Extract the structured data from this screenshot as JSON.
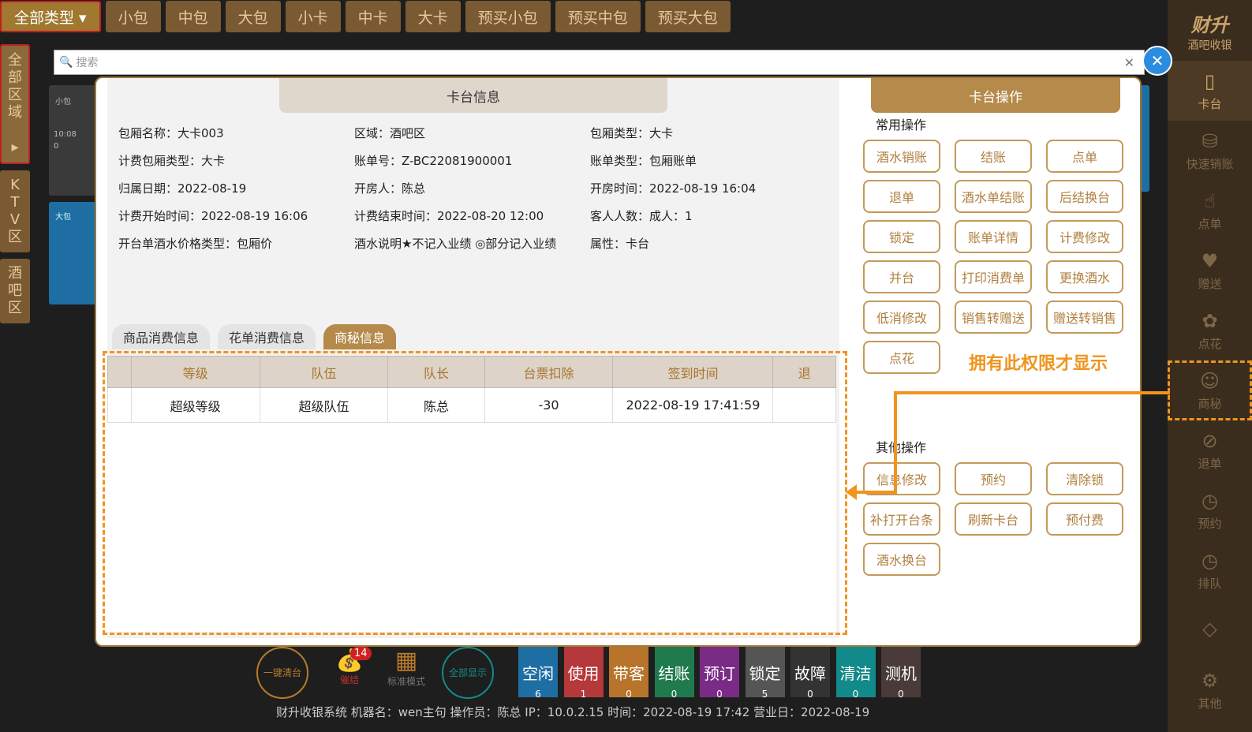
{
  "topbar": {
    "tabs": [
      "全部类型 ▾",
      "小包",
      "中包",
      "大包",
      "小卡",
      "中卡",
      "大卡",
      "预买小包",
      "预买中包",
      "预买大包"
    ]
  },
  "left_zones": [
    "全部区域 ▸",
    "KTV区",
    "酒吧区"
  ],
  "search": {
    "placeholder": "搜索"
  },
  "brand": {
    "title": "财升",
    "subtitle": "酒吧收银"
  },
  "right_nav": [
    "卡台",
    "快速销账",
    "点单",
    "赠送",
    "点花",
    "商秘",
    "退单",
    "预约",
    "排队",
    "",
    "其他"
  ],
  "bg_cards": {
    "card1_label": "小包",
    "card1_time": "10:08",
    "card1_count": "0",
    "card2_label": "大包"
  },
  "bottom": {
    "circle1": "一键清台",
    "reminder_label": "催结",
    "reminder_count": "14",
    "mode_label": "标准模式",
    "circle2": "全部显示",
    "statuses": [
      {
        "label": "空闲",
        "count": "6",
        "color": "#1f6ea3"
      },
      {
        "label": "使用",
        "count": "1",
        "color": "#b5383a"
      },
      {
        "label": "带客",
        "count": "0",
        "color": "#b8742a"
      },
      {
        "label": "结账",
        "count": "0",
        "color": "#1f7a4e"
      },
      {
        "label": "预订",
        "count": "0",
        "color": "#7a2b86"
      },
      {
        "label": "锁定",
        "count": "5",
        "color": "#555555"
      },
      {
        "label": "故障",
        "count": "0",
        "color": "#333333"
      },
      {
        "label": "清洁",
        "count": "0",
        "color": "#128a8a"
      },
      {
        "label": "测机",
        "count": "0",
        "color": "#4a3a3a"
      }
    ],
    "status_line": "财升收银系统    机器名：wen主句    操作员：陈总    IP：10.0.2.15    时间：2022-08-19 17:42    营业日：2022-08-19"
  },
  "modal": {
    "left_title": "卡台信息",
    "info_rows": [
      [
        "包厢名称：大卡003",
        "区域：酒吧区",
        "包厢类型：大卡"
      ],
      [
        "计费包厢类型：大卡",
        "账单号：Z-BC22081900001",
        "账单类型：包厢账单"
      ],
      [
        "归属日期：2022-08-19",
        "开房人：陈总",
        "开房时间：2022-08-19 16:04"
      ],
      [
        "计费开始时间：2022-08-19 16:06",
        "计费结束时间：2022-08-20 12:00",
        "客人人数：成人：1"
      ],
      [
        "开台单酒水价格类型：包厢价",
        "酒水说明★不记入业绩 ◎部分记入业绩",
        "属性：卡台"
      ]
    ],
    "tabs": [
      "商品消费信息",
      "花单消费信息",
      "商秘信息"
    ],
    "table": {
      "headers": [
        "等级",
        "队伍",
        "队长",
        "台票扣除",
        "签到时间",
        "退"
      ],
      "rows": [
        [
          "超级等级",
          "超级队伍",
          "陈总",
          "-30",
          "2022-08-19 17:41:59",
          ""
        ]
      ]
    },
    "right_title": "卡台操作",
    "common_label": "常用操作",
    "common_ops": [
      "酒水销账",
      "结账",
      "点单",
      "退单",
      "酒水单结账",
      "后结换台",
      "锁定",
      "账单详情",
      "计费修改",
      "并台",
      "打印消费单",
      "更换酒水",
      "低消修改",
      "销售转赠送",
      "赠送转销售",
      "点花"
    ],
    "note": "拥有此权限才显示",
    "other_label": "其他操作",
    "other_ops": [
      "信息修改",
      "预约",
      "清除锁",
      "补打开台条",
      "刷新卡台",
      "预付费",
      "酒水换台"
    ]
  }
}
